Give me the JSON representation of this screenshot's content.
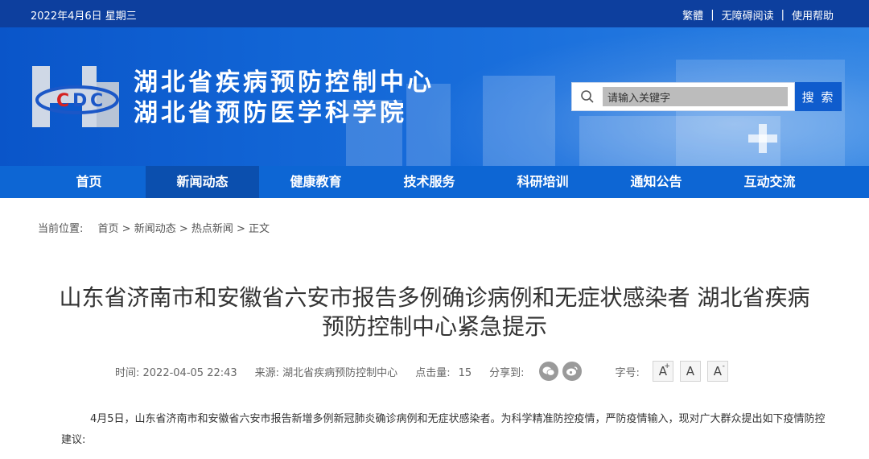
{
  "topbar": {
    "date": "2022年4月6日 星期三",
    "links": [
      "繁體",
      "无障碍阅读",
      "使用帮助"
    ],
    "separator": "|"
  },
  "header": {
    "title_line1": "湖北省疾病预防控制中心",
    "title_line2": "湖北省预防医学科学院",
    "logo_icon": "hbcdc-logo-icon"
  },
  "search": {
    "placeholder": "请输入关键字",
    "button_label": "搜 索",
    "icon": "search-icon"
  },
  "nav": {
    "items": [
      "首页",
      "新闻动态",
      "健康教育",
      "技术服务",
      "科研培训",
      "通知公告",
      "互动交流"
    ],
    "active_index": 1
  },
  "breadcrumb": {
    "label": "当前位置:",
    "path": "首页 > 新闻动态 > 热点新闻 > 正文"
  },
  "article": {
    "title_line1": "山东省济南市和安徽省六安市报告多例确诊病例和无症状感染者 湖北省疾病",
    "title_line2": "预防控制中心紧急提示",
    "meta": {
      "time": "时间:  2022-04-05 22:43",
      "source": "来源:  湖北省疾病预防控制中心",
      "clicks_label": "点击量:",
      "clicks_value": "15",
      "share_label": "分享到:",
      "share_icons": [
        "wechat-icon",
        "weibo-icon"
      ],
      "font_label": "字号:",
      "font_buttons": [
        "A",
        "A",
        "A"
      ],
      "font_button_marks": [
        "+",
        "",
        "-"
      ]
    },
    "paragraph": "4月5日，山东省济南市和安徽省六安市报告新增多例新冠肺炎确诊病例和无症状感染者。为科学精准防控疫情，严防疫情输入，现对广大群众提出如下疫情防控建议:"
  },
  "colors": {
    "topbar": "#0d3f9e",
    "nav": "#0d66d4",
    "nav_active": "#0b4fae",
    "search_button": "#0f5ccd"
  }
}
